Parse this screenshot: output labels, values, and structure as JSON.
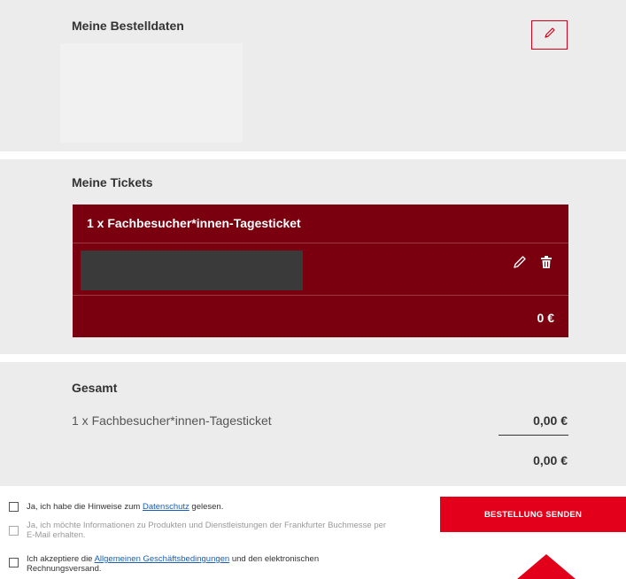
{
  "order": {
    "title": "Meine Bestelldaten",
    "edit_icon": "pencil-icon"
  },
  "tickets": {
    "title": "Meine Tickets",
    "items": [
      {
        "name": "1 x Fachbesucher*innen-Tagesticket",
        "price": "0 €",
        "edit_icon": "pencil-icon",
        "delete_icon": "trash-icon"
      }
    ]
  },
  "total": {
    "title": "Gesamt",
    "line_label": "1 x Fachbesucher*innen-Tagesticket",
    "line_amount": "0,00 €",
    "sum": "0,00 €"
  },
  "consents": {
    "privacy": {
      "before": "Ja, ich habe die Hinweise zum ",
      "link": "Datenschutz",
      "after": " gelesen."
    },
    "newsletter": {
      "text": "Ja, ich möchte Informationen zu Produkten und Dienstleistungen der Frankfurter Buchmesse per E-Mail erhalten."
    },
    "terms": {
      "before": "Ich akzeptiere die ",
      "link": "Allgemeinen Geschäftsbedingungen",
      "after": " und den elektronischen Rechnungsversand."
    }
  },
  "submit": {
    "label": "BESTELLUNG SENDEN"
  },
  "colors": {
    "accent": "#e2001a",
    "ticket_bg": "#7a000f",
    "panel_bg": "#ececec",
    "link": "#1a5fb4"
  }
}
